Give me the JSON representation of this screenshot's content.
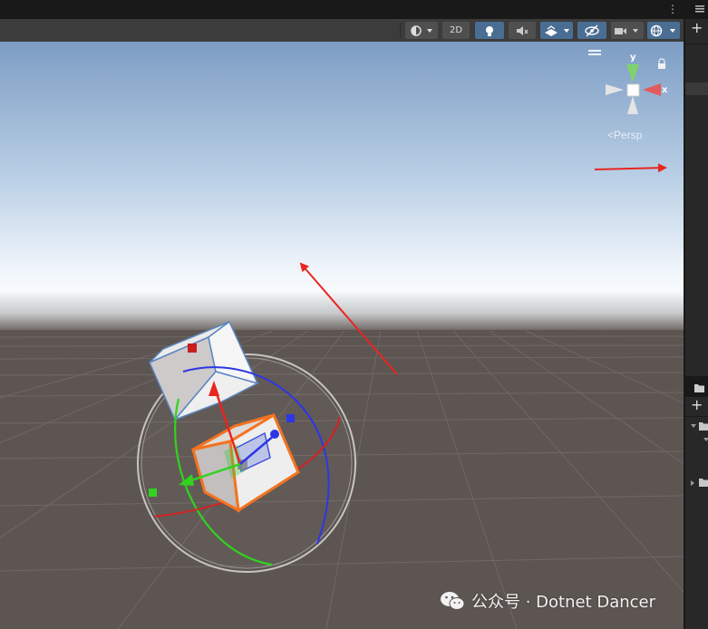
{
  "toolbar": {
    "btn_2d_label": "2D"
  },
  "scene": {
    "persp_label": "Persp",
    "gizmo_y_label": "y",
    "gizmo_x_label": "x"
  },
  "watermark": {
    "text": "公众号 · Dotnet Dancer"
  },
  "colors": {
    "sky_top": "#7d9dc4",
    "horizon": "#f2f6fb",
    "ground": "#5d5551",
    "active_button": "#4a6e93",
    "arrow_red": "#e8261f",
    "selection_orange": "#f37321"
  },
  "icons": [
    "kebab-menu-icon",
    "shading-mode-icon",
    "lighting-icon",
    "audio-icon",
    "effects-icon",
    "hidden-objects-icon",
    "camera-icon",
    "gizmos-icon",
    "lock-icon",
    "add-icon",
    "folder-icon",
    "wechat-icon"
  ]
}
